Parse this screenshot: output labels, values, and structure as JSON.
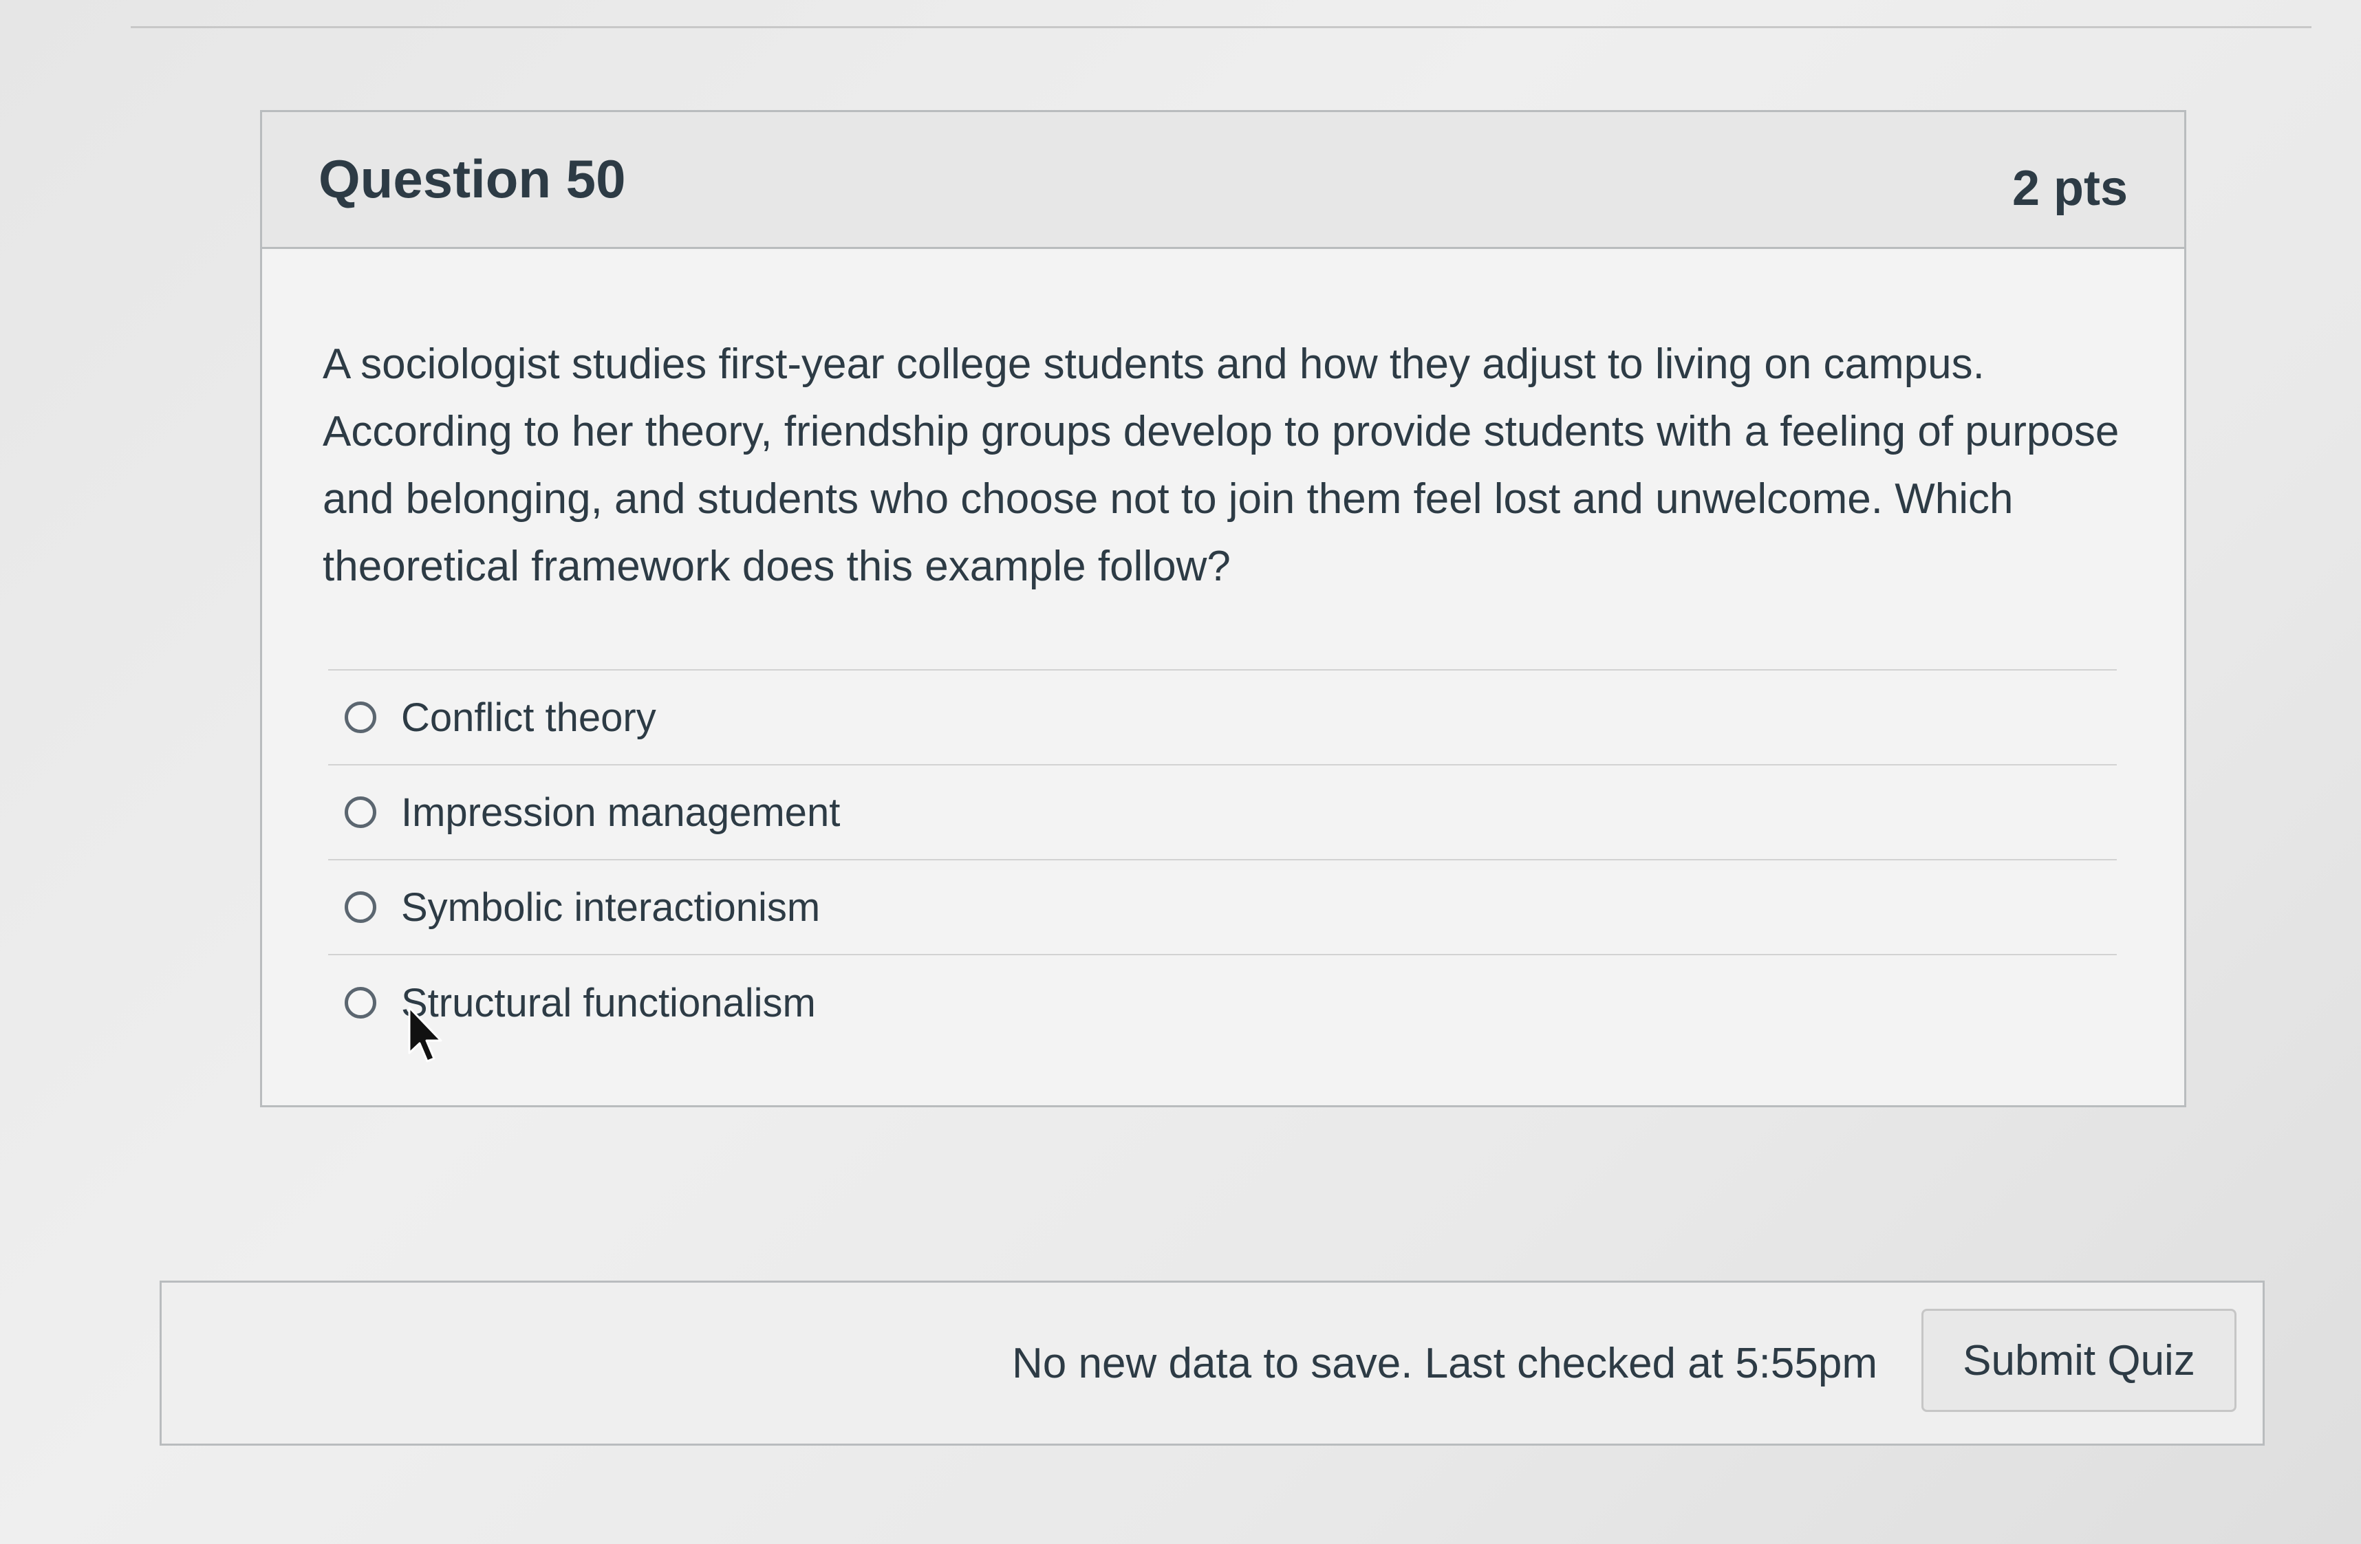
{
  "question": {
    "title": "Question 50",
    "points": "2 pts",
    "text": "A sociologist studies first-year college students and how they adjust to living on campus. According to her theory, friendship groups develop to provide students with a feeling of purpose and belonging, and students who choose not to join them feel lost and unwelcome. Which theoretical framework does this example follow?",
    "answers": [
      {
        "label": "Conflict theory",
        "selected": false
      },
      {
        "label": "Impression management",
        "selected": false
      },
      {
        "label": "Symbolic interactionism",
        "selected": false
      },
      {
        "label": "Structural functionalism",
        "selected": false
      }
    ]
  },
  "footer": {
    "status_text": "No new data to save. Last checked at 5:55pm",
    "submit_label": "Submit Quiz"
  },
  "icons": {
    "radio": "radio-unchecked-icon",
    "cursor": "mouse-pointer-icon"
  }
}
